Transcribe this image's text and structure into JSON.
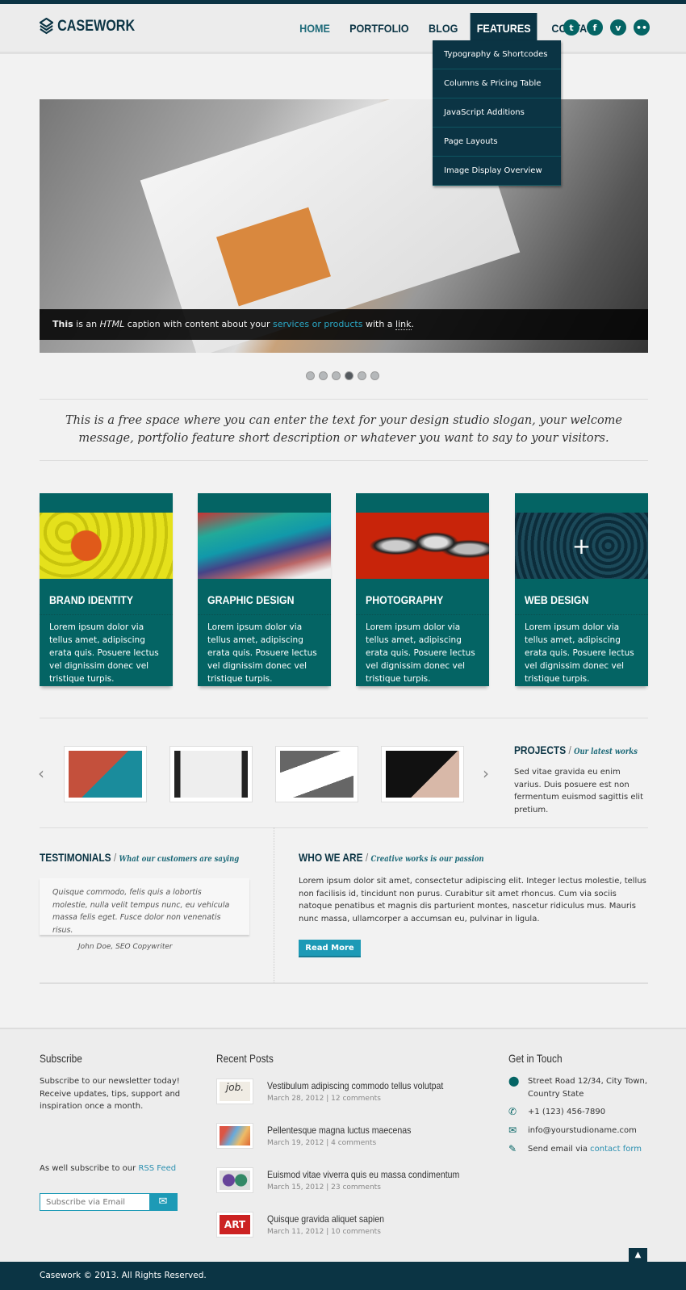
{
  "header": {
    "logo": "CASEWORK",
    "nav": [
      {
        "label": "HOME"
      },
      {
        "label": "PORTFOLIO"
      },
      {
        "label": "BLOG"
      },
      {
        "label": "FEATURES"
      },
      {
        "label": "CONTACT"
      }
    ],
    "social": [
      {
        "icon": "twitter-icon",
        "glyph": "t"
      },
      {
        "icon": "facebook-icon",
        "glyph": "f"
      },
      {
        "icon": "vimeo-icon",
        "glyph": "v"
      },
      {
        "icon": "flickr-icon",
        "glyph": "••"
      }
    ],
    "dropdown": [
      "Typography & Shortcodes",
      "Columns & Pricing Table",
      "JavaScript Additions",
      "Page Layouts",
      "Image Display Overview"
    ]
  },
  "slider": {
    "caption": {
      "bold": "This",
      "t1": " is an ",
      "em": "HTML",
      "t2": " caption with content about your ",
      "link": "services or products",
      "t3": " with a ",
      "link2": "link",
      "t4": "."
    },
    "slides": 6,
    "active": 4
  },
  "slogan": "This is a free space where you can enter the text for your design studio slogan, your welcome message, portfolio feature short description or whatever you want to say to your visitors.",
  "services": [
    {
      "title": "BRAND IDENTITY",
      "text": "Lorem ipsum dolor via tellus amet, adipiscing erata quis. Posuere lectus vel dignissim donec vel tristique turpis."
    },
    {
      "title": "GRAPHIC DESIGN",
      "text": "Lorem ipsum dolor via tellus amet, adipiscing erata quis. Posuere lectus vel dignissim donec vel tristique turpis."
    },
    {
      "title": "PHOTOGRAPHY",
      "text": "Lorem ipsum dolor via tellus amet, adipiscing erata quis. Posuere lectus vel dignissim donec vel tristique turpis."
    },
    {
      "title": "WEB DESIGN",
      "text": "Lorem ipsum dolor via tellus amet, adipiscing erata quis. Posuere lectus vel dignissim donec vel tristique turpis."
    }
  ],
  "projects": {
    "title": "PROJECTS",
    "sub": "Our latest works",
    "text": "Sed vitae gravida eu enim varius. Duis posuere est non fermentum euismod sagittis elit pretium."
  },
  "testimonials": {
    "title": "TESTIMONIALS",
    "sub": "What our customers are saying",
    "quote": "Quisque commodo, felis quis a lobortis molestie, nulla velit tempus nunc, eu vehicula massa felis eget. Fusce dolor non venenatis risus.",
    "author": "John Doe, SEO Copywriter"
  },
  "who": {
    "title": "WHO WE ARE",
    "sub": "Creative works is our passion",
    "text": "Lorem ipsum dolor sit amet, consectetur adipiscing elit. Integer lectus molestie, tellus non facilisis id, tincidunt non purus. Curabitur sit amet rhoncus. Cum via sociis natoque penatibus et magnis dis parturient montes, nascetur ridiculus mus. Mauris nunc massa, ullamcorper a accumsan eu, pulvinar in ligula.",
    "button": "Read More"
  },
  "footer": {
    "subscribe": {
      "title": "Subscribe",
      "text": "Subscribe to our newsletter today! Receive updates, tips, support and inspiration once a month.",
      "placeholder": "Subscribe via Email",
      "rss_pre": "As well subscribe to our ",
      "rss": "RSS Feed"
    },
    "recent": {
      "title": "Recent Posts",
      "posts": [
        {
          "title": "Vestibulum adipiscing commodo tellus volutpat",
          "meta": "March 28, 2012 | 12 comments"
        },
        {
          "title": "Pellentesque magna luctus maecenas",
          "meta": "March 19, 2012 | 4 comments"
        },
        {
          "title": "Euismod vitae viverra quis eu massa condimentum",
          "meta": "March 15, 2012 | 23 comments"
        },
        {
          "title": "Quisque gravida aliquet sapien",
          "meta": "March 11, 2012 | 10 comments"
        }
      ]
    },
    "contact": {
      "title": "Get in Touch",
      "address": "Street Road 12/34, City Town, Country State",
      "phone": "+1 (123) 456-7890",
      "email": "info@yourstudioname.com",
      "form_pre": "Send email via ",
      "form": "contact form"
    },
    "copyright": "Casework © 2013. All Rights Reserved."
  },
  "colors": {
    "navy": "#0b3444",
    "teal": "#046464",
    "accent": "#1d9ab6"
  }
}
